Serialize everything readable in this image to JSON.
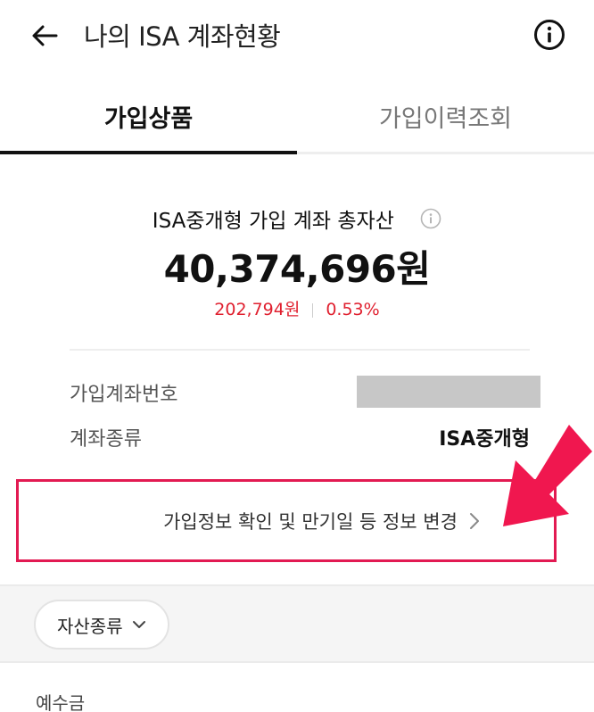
{
  "header": {
    "title": "나의 ISA 계좌현황",
    "back_icon": "arrow-left-icon",
    "info_icon": "info-circle-icon"
  },
  "tabs": [
    {
      "label": "가입상품",
      "active": true
    },
    {
      "label": "가입이력조회",
      "active": false
    }
  ],
  "summary": {
    "label": "ISA중개형 가입 계좌 총자산",
    "total": "40,374,696원",
    "change_amount": "202,794원",
    "change_rate": "0.53%",
    "change_color": "#e0202f"
  },
  "account": {
    "number_label": "가입계좌번호",
    "type_label": "계좌종류",
    "type_value": "ISA중개형"
  },
  "change_info_button": {
    "label": "가입정보 확인 및 만기일 등 정보 변경",
    "highlight_color": "#e21a52"
  },
  "filter": {
    "chip_label": "자산종류"
  },
  "section": {
    "deposit_label": "예수금"
  },
  "colors": {
    "accent_red": "#e0202f",
    "annotation_pink": "#f0174f"
  }
}
